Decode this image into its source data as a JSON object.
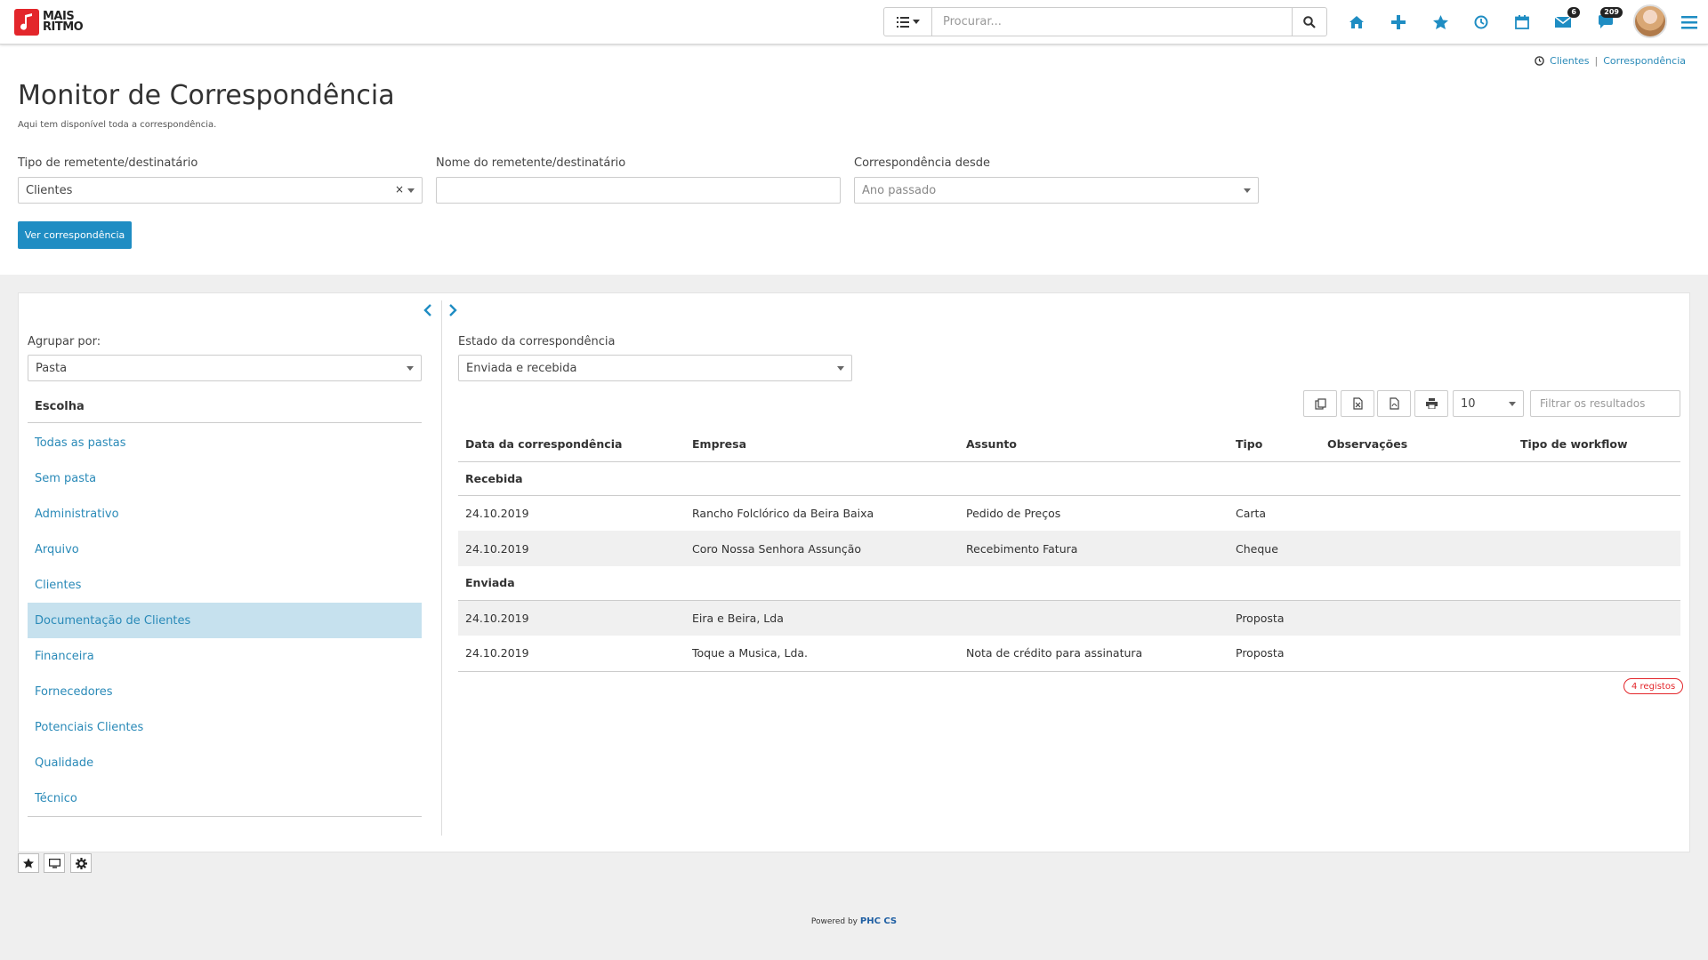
{
  "brand": {
    "line1": "MAIS",
    "line2": "RITMO",
    "color": "#e3262b"
  },
  "search": {
    "placeholder": "Procurar..."
  },
  "nav": {
    "icons": [
      "home-icon",
      "plus-icon",
      "star-icon",
      "clock-icon",
      "calendar-icon",
      "mail-icon",
      "chat-icon",
      "hamburger-icon"
    ],
    "mail_badge": "6",
    "chat_badge": "209",
    "accent": "#1f8dc3"
  },
  "breadcrumb": {
    "first": "Clientes",
    "sep": "|",
    "second": "Correspondência"
  },
  "page": {
    "title": "Monitor de Correspondência",
    "subtitle": "Aqui tem disponível toda a correspondência."
  },
  "filters": {
    "type_label": "Tipo de remetente/destinatário",
    "type_value": "Clientes",
    "name_label": "Nome do remetente/destinatário",
    "name_value": "",
    "since_label": "Correspondência desde",
    "since_placeholder": "Ano passado",
    "view_button": "Ver correspondência"
  },
  "left": {
    "group_label": "Agrupar por:",
    "group_value": "Pasta",
    "header": "Escolha",
    "folders": [
      "Todas as pastas",
      "Sem pasta",
      "Administrativo",
      "Arquivo",
      "Clientes",
      "Documentação de Clientes",
      "Financeira",
      "Fornecedores",
      "Potenciais Clientes",
      "Qualidade",
      "Técnico"
    ],
    "active_folder": "Documentação de Clientes"
  },
  "right": {
    "state_label": "Estado da correspondência",
    "state_value": "Enviada e recebida",
    "page_size": "10",
    "filter_placeholder": "Filtrar os resultados",
    "columns": [
      "Data da correspondência",
      "Empresa",
      "Assunto",
      "Tipo",
      "Observações",
      "Tipo de workflow"
    ],
    "groups": [
      {
        "name": "Recebida",
        "rows": [
          {
            "date": "24.10.2019",
            "company": "Rancho Folclórico da Beira Baixa",
            "subject": "Pedido de Preços",
            "type": "Carta",
            "notes": "",
            "workflow": ""
          },
          {
            "date": "24.10.2019",
            "company": "Coro Nossa Senhora Assunção",
            "subject": "Recebimento Fatura",
            "type": "Cheque",
            "notes": "",
            "workflow": ""
          }
        ]
      },
      {
        "name": "Enviada",
        "rows": [
          {
            "date": "24.10.2019",
            "company": "Eira e Beira, Lda",
            "subject": "",
            "type": "Proposta",
            "notes": "",
            "workflow": ""
          },
          {
            "date": "24.10.2019",
            "company": "Toque a Musica, Lda.",
            "subject": "Nota de crédito para assinatura",
            "type": "Proposta",
            "notes": "",
            "workflow": ""
          }
        ]
      }
    ],
    "records": "4 registos"
  },
  "footer": {
    "prefix": "Powered by",
    "brand": "PHC CS"
  }
}
